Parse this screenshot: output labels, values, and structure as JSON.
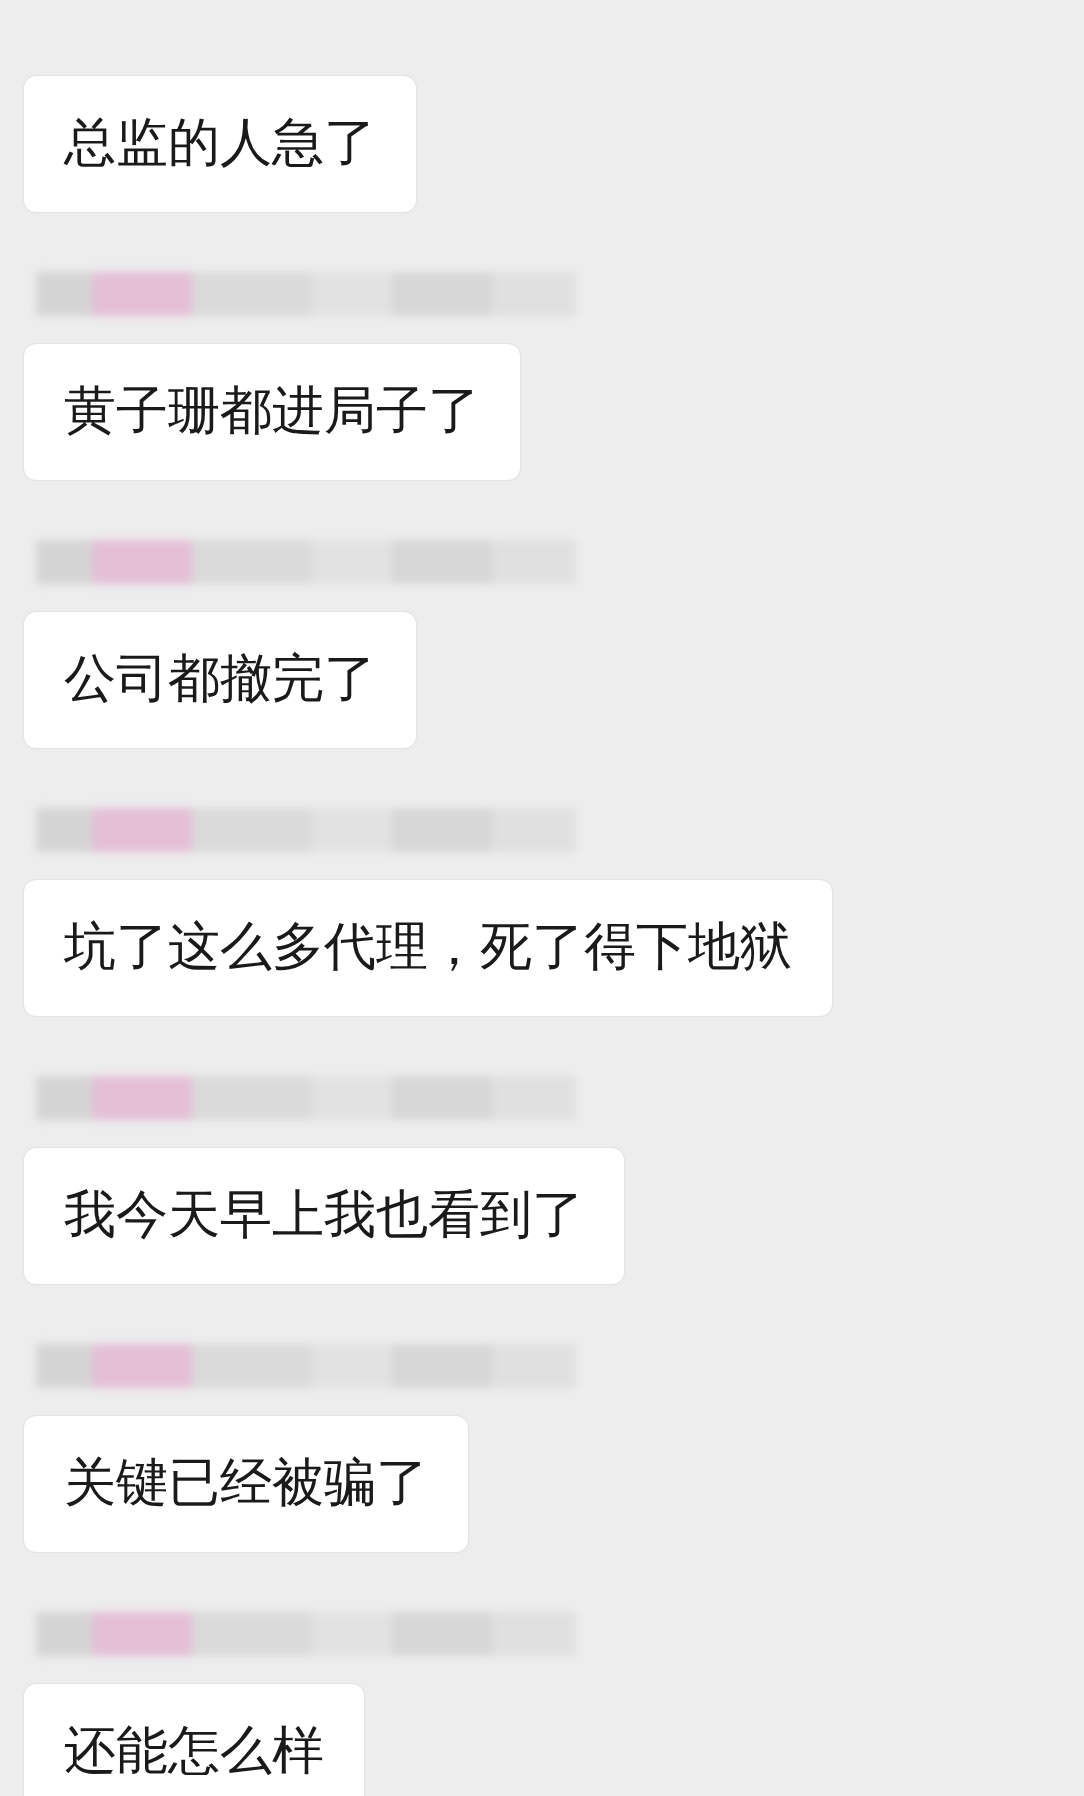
{
  "messages": [
    {
      "text": "总监的人急了",
      "name_blurred": false
    },
    {
      "text": "黄子珊都进局子了",
      "name_blurred": true
    },
    {
      "text": "公司都撤完了",
      "name_blurred": true
    },
    {
      "text": "坑了这么多代理，死了得下地狱",
      "name_blurred": true
    },
    {
      "text": "我今天早上我也看到了",
      "name_blurred": true
    },
    {
      "text": "关键已经被骗了",
      "name_blurred": true
    },
    {
      "text": "还能怎么样",
      "name_blurred": true
    }
  ]
}
